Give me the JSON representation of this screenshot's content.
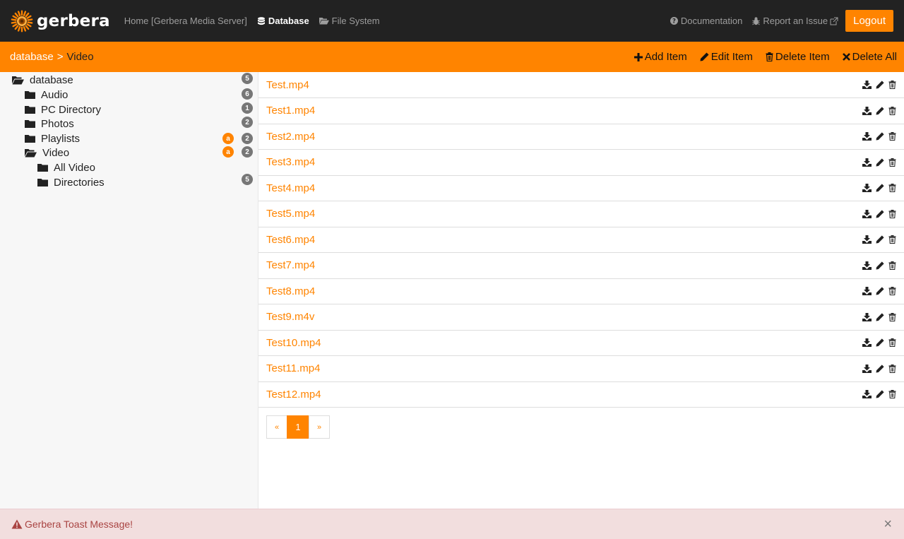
{
  "header": {
    "brand": "gerbera",
    "nav": [
      {
        "label": "Home [Gerbera Media Server]",
        "icon": "none",
        "active": false
      },
      {
        "label": "Database",
        "icon": "database-icon",
        "active": true
      },
      {
        "label": "File System",
        "icon": "folder-open-icon",
        "active": false
      }
    ],
    "documentation": "Documentation",
    "report_issue": "Report an Issue",
    "logout": "Logout"
  },
  "breadcrumb": {
    "root": "database",
    "separator": ">",
    "current": "Video"
  },
  "actions": [
    {
      "label": "Add Item",
      "icon": "plus-icon"
    },
    {
      "label": "Edit Item",
      "icon": "pencil-icon"
    },
    {
      "label": "Delete Item",
      "icon": "trash-icon"
    },
    {
      "label": "Delete All",
      "icon": "x-icon"
    }
  ],
  "tree": [
    {
      "label": "database",
      "open": true,
      "depth": 0,
      "badge": "5",
      "autoscan": ""
    },
    {
      "label": "Audio",
      "open": false,
      "depth": 1,
      "badge": "6",
      "autoscan": ""
    },
    {
      "label": "PC Directory",
      "open": false,
      "depth": 1,
      "badge": "1",
      "autoscan": ""
    },
    {
      "label": "Photos",
      "open": false,
      "depth": 1,
      "badge": "2",
      "autoscan": ""
    },
    {
      "label": "Playlists",
      "open": false,
      "depth": 1,
      "badge": "2",
      "autoscan": "a"
    },
    {
      "label": "Video",
      "open": true,
      "depth": 1,
      "badge": "2",
      "autoscan": "a"
    },
    {
      "label": "All Video",
      "open": false,
      "depth": 2,
      "badge": "",
      "autoscan": ""
    },
    {
      "label": "Directories",
      "open": false,
      "depth": 2,
      "badge": "5",
      "autoscan": ""
    }
  ],
  "items": [
    "Test.mp4",
    "Test1.mp4",
    "Test2.mp4",
    "Test3.mp4",
    "Test4.mp4",
    "Test5.mp4",
    "Test6.mp4",
    "Test7.mp4",
    "Test8.mp4",
    "Test9.m4v",
    "Test10.mp4",
    "Test11.mp4",
    "Test12.mp4"
  ],
  "pagination": {
    "prev": "«",
    "current": "1",
    "next": "»"
  },
  "toast": {
    "message": "Gerbera Toast Message!",
    "close": "×"
  },
  "colors": {
    "accent": "#ff8400",
    "navbar": "#222222",
    "toast_bg": "#f2dede",
    "toast_text": "#a94442"
  }
}
